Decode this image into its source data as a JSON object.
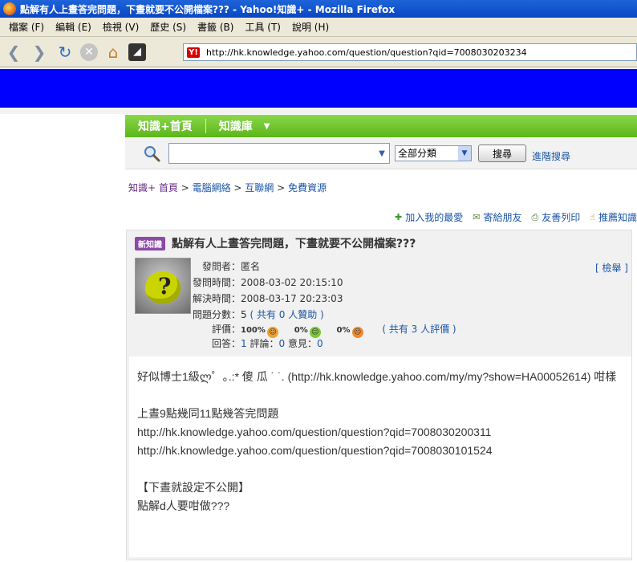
{
  "window": {
    "title": "點解有人上晝答完問題，下晝就要不公開檔案??? - Yahoo!知識+ - Mozilla Firefox"
  },
  "menu": [
    "檔案 (F)",
    "編輯 (E)",
    "檢視 (V)",
    "歷史 (S)",
    "書籤 (B)",
    "工具 (T)",
    "說明 (H)"
  ],
  "nav": {
    "url": "http://hk.knowledge.yahoo.com/question/question?qid=7008030203234"
  },
  "site_nav": {
    "home": "知識+首頁",
    "library": "知識庫"
  },
  "search": {
    "category": "全部分類",
    "button": "搜尋",
    "advanced": "進階搜尋"
  },
  "breadcrumb": [
    "知識+ 首頁",
    "電腦網絡",
    "互聯網",
    "免費資源"
  ],
  "actions": [
    "加入我的最愛",
    "寄給朋友",
    "友善列印",
    "推薦知識"
  ],
  "question": {
    "badge": "新知識",
    "title": "點解有人上晝答完問題，下晝就要不公開檔案???",
    "report": "[ 檢舉 ]",
    "asker_label": "發問者：",
    "asker": "匿名",
    "asked_label": "發問時間：",
    "asked": "2008-03-02 20:15:10",
    "solved_label": "解決時間：",
    "solved": "2008-03-17 20:23:03",
    "points_label": "問題分數：",
    "points": "5",
    "points_note": "( 共有 0 人贊助 )",
    "rating_label": "評價：",
    "rating_good": "100%",
    "rating_neutral": "0%",
    "rating_bad": "0%",
    "rating_note": "( 共有 3 人評價 )",
    "answers_label": "回答：",
    "answers": "1",
    "comments_label": "評論：",
    "comments": "0",
    "opinions_label": "意見：",
    "opinions": "0"
  },
  "answer": {
    "lines": [
      "好似博士1級ლ゜｡.:* 傻 瓜 ˙ ˙. (http://hk.knowledge.yahoo.com/my/my?show=HA00052614) 咁樣",
      "",
      "上晝9點幾同11點幾答完問題",
      "http://hk.knowledge.yahoo.com/question/question?qid=7008030200311",
      "http://hk.knowledge.yahoo.com/question/question?qid=7008030101524",
      "",
      "【下晝就設定不公開】",
      "點解d人要咁做???"
    ]
  },
  "colors": {
    "site_green": "#6cc22a",
    "link_blue": "#1a55a8",
    "badge_purple": "#8b4aa5",
    "banner_blue": "#0000ff"
  }
}
